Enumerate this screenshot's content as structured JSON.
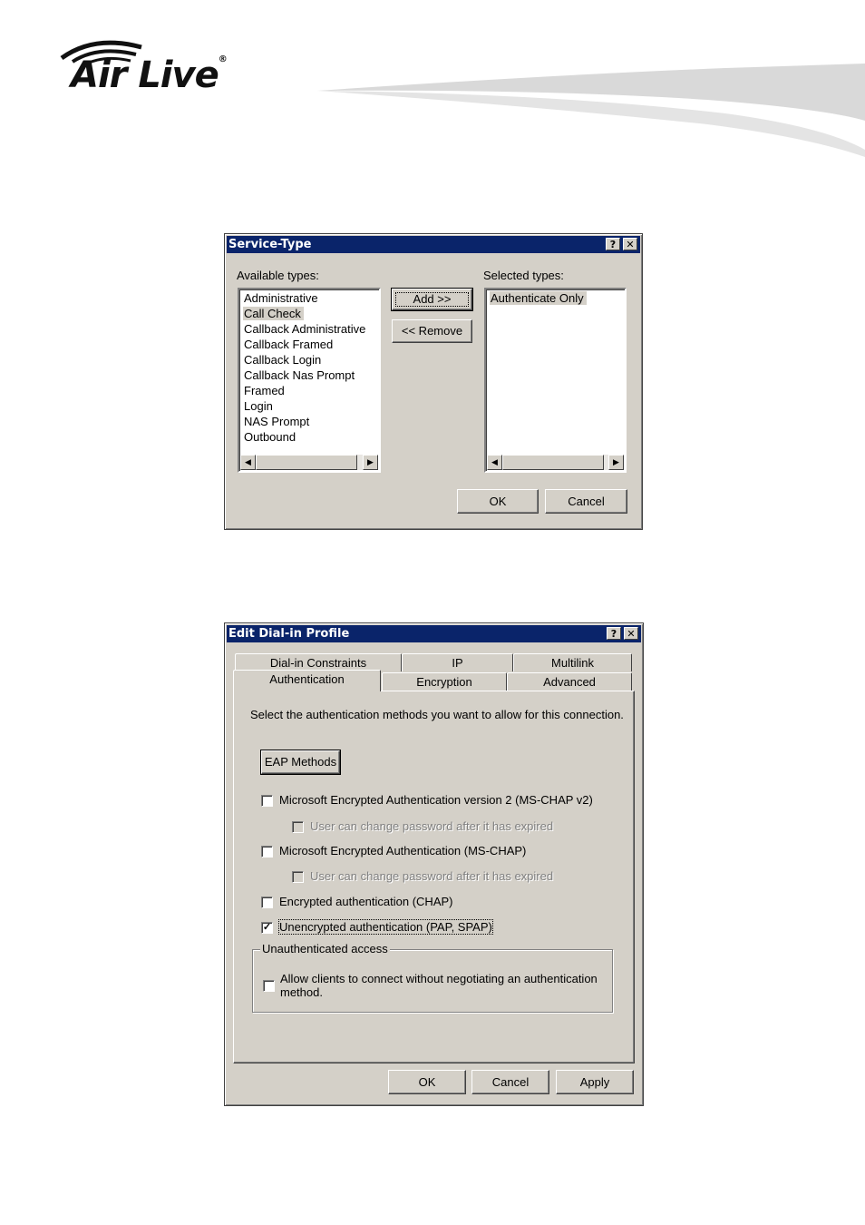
{
  "logo": {
    "text": "Air Live",
    "reg": "®"
  },
  "service_type": {
    "title": "Service-Type",
    "help_glyph": "?",
    "close_glyph": "✕",
    "available_label": "Available types:",
    "selected_label": "Selected types:",
    "available_items": [
      "Administrative",
      "Call Check",
      "Callback Administrative",
      "Callback Framed",
      "Callback Login",
      "Callback Nas Prompt",
      "Framed",
      "Login",
      "NAS Prompt",
      "Outbound"
    ],
    "selected_items": [
      "Authenticate Only"
    ],
    "add_label": "Add >>",
    "remove_label": "<< Remove",
    "ok_label": "OK",
    "cancel_label": "Cancel"
  },
  "dialin": {
    "title": "Edit Dial-in Profile",
    "help_glyph": "?",
    "close_glyph": "✕",
    "tabs_row1": [
      "Dial-in Constraints",
      "IP",
      "Multilink"
    ],
    "tabs_row2": [
      "Authentication",
      "Encryption",
      "Advanced"
    ],
    "active_tab": "Authentication",
    "intro": "Select the authentication methods you want to allow for this connection.",
    "eap_label": "EAP Methods",
    "options": [
      {
        "label": "Microsoft Encrypted Authentication version 2 (MS-CHAP v2)",
        "checked": false
      },
      {
        "label": "User can change password after it has expired",
        "checked": false,
        "disabled": true
      },
      {
        "label": "Microsoft Encrypted Authentication (MS-CHAP)",
        "checked": false
      },
      {
        "label": "User can change password after it has expired",
        "checked": false,
        "disabled": true
      },
      {
        "label": "Encrypted authentication (CHAP)",
        "checked": false
      },
      {
        "label": "Unencrypted authentication (PAP, SPAP)",
        "checked": true
      }
    ],
    "group_label": "Unauthenticated access",
    "allow_line1": "Allow clients to connect without negotiating an authentication",
    "allow_line2": "method.",
    "check_glyph": "✓",
    "ok_label": "OK",
    "cancel_label": "Cancel",
    "apply_label": "Apply"
  }
}
